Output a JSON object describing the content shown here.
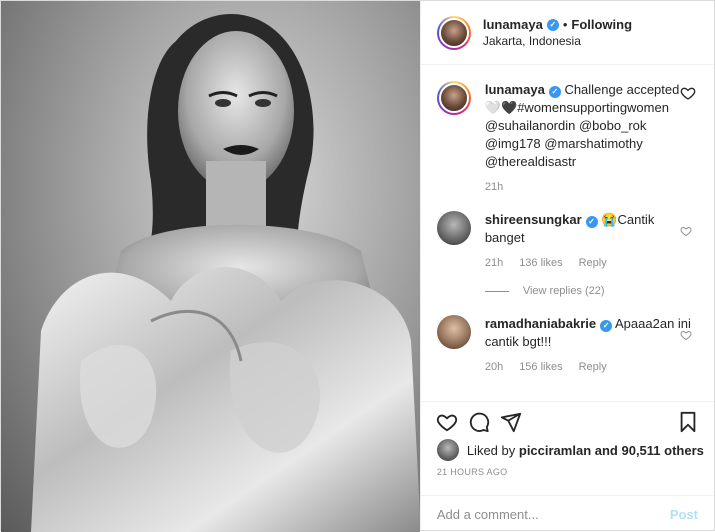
{
  "photo": {
    "alt": ""
  },
  "header": {
    "username": "lunamaya",
    "separator": "•",
    "following_label": "Following",
    "location": "Jakarta, Indonesia"
  },
  "caption": {
    "username": "lunamaya",
    "text": "Challenge accepted 🤍🖤#womensupportingwomen @suhailanordin @bobo_rok @img178 @marshatimothy @therealdisastr",
    "time": "21h"
  },
  "comments": [
    {
      "username": "shireensungkar",
      "text": "😭Cantik banget",
      "time": "21h",
      "likes": "136 likes",
      "reply": "Reply"
    },
    {
      "username": "ramadhaniabakrie",
      "text": "Apaaa2an ini cantik bgt!!!",
      "time": "20h",
      "likes": "156 likes",
      "reply": "Reply"
    }
  ],
  "view_replies": "View replies (22)",
  "likes": {
    "prefix": "Liked by",
    "user": "picciramlan",
    "suffix": "and 90,511 others"
  },
  "timestamp": "21 HOURS AGO",
  "add_comment": {
    "placeholder": "Add a comment...",
    "post_label": "Post"
  },
  "icons": [
    "heart-icon",
    "comment-icon",
    "share-icon",
    "bookmark-icon",
    "verified-badge-icon"
  ],
  "colors": {
    "accent": "#3897f0",
    "post_disabled": "#b2dffc",
    "muted": "#8e8e8e"
  }
}
